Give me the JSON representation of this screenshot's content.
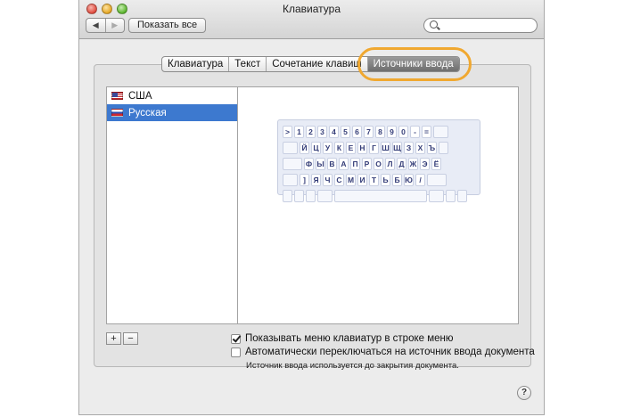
{
  "window": {
    "title": "Клавиатура"
  },
  "toolbar": {
    "back_label": "◀",
    "forward_label": "▶",
    "show_all_label": "Показать все",
    "search_placeholder": ""
  },
  "tabs": [
    {
      "label": "Клавиатура"
    },
    {
      "label": "Текст"
    },
    {
      "label": "Сочетание клавиш"
    },
    {
      "label": "Источники ввода",
      "active": true
    }
  ],
  "sources": [
    {
      "label": "США",
      "flag": "flag-us-icon"
    },
    {
      "label": "Русская",
      "flag": "flag-ru-icon",
      "selected": true
    }
  ],
  "keyboard": {
    "rows": [
      [
        ">",
        "1",
        "2",
        "3",
        "4",
        "5",
        "6",
        "7",
        "8",
        "9",
        "0",
        "-",
        "="
      ],
      [
        "Й",
        "Ц",
        "У",
        "К",
        "Е",
        "Н",
        "Г",
        "Ш",
        "Щ",
        "З",
        "Х",
        "Ъ"
      ],
      [
        "Ф",
        "Ы",
        "В",
        "А",
        "П",
        "Р",
        "О",
        "Л",
        "Д",
        "Ж",
        "Э",
        "Ё"
      ],
      [
        "]",
        "Я",
        "Ч",
        "С",
        "М",
        "И",
        "Т",
        "Ь",
        "Б",
        "Ю",
        "/"
      ]
    ]
  },
  "buttons": {
    "add_label": "+",
    "remove_label": "−",
    "help_label": "?"
  },
  "options": {
    "show_menu_label": "Показывать меню клавиатур в строке меню",
    "auto_switch_label": "Автоматически переключаться на источник ввода документа",
    "hint": "Источник ввода используется до закрытия документа."
  },
  "colors": {
    "selection": "#3d79cf",
    "highlight_ring": "#f0a830",
    "key_text": "#343d78"
  }
}
